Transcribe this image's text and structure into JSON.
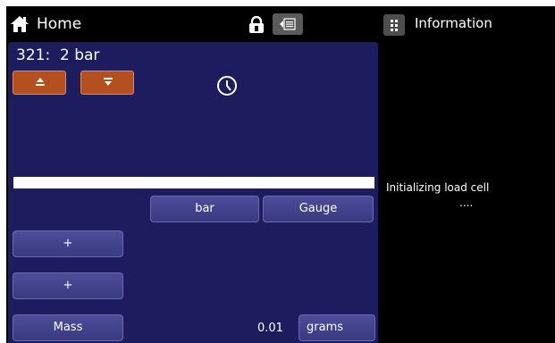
{
  "header": {
    "home_label": "Home",
    "info_title": "Information",
    "icons": [
      "home-icon",
      "lock-icon",
      "menu-icon",
      "grid-icon"
    ]
  },
  "channel": {
    "label": "321:  2 bar",
    "buttons": {
      "high_icon": "arrow-up-bar-icon",
      "low_icon": "arrow-down-bar-icon",
      "clock_icon": "clock-icon"
    },
    "unit_label": "bar",
    "mode_label": "Gauge",
    "plus_label_1": "+",
    "plus_label_2": "+",
    "mass_label": "Mass",
    "mass_value": "0.01",
    "mass_unit": "grams"
  },
  "info": {
    "message": "Initializing load cell",
    "dots": "...."
  },
  "colors": {
    "screen_bg": "#000000",
    "panel_bg": "#1c1c5e",
    "button_bg": "#3f3f88",
    "accent_orange": "#b4501f"
  }
}
